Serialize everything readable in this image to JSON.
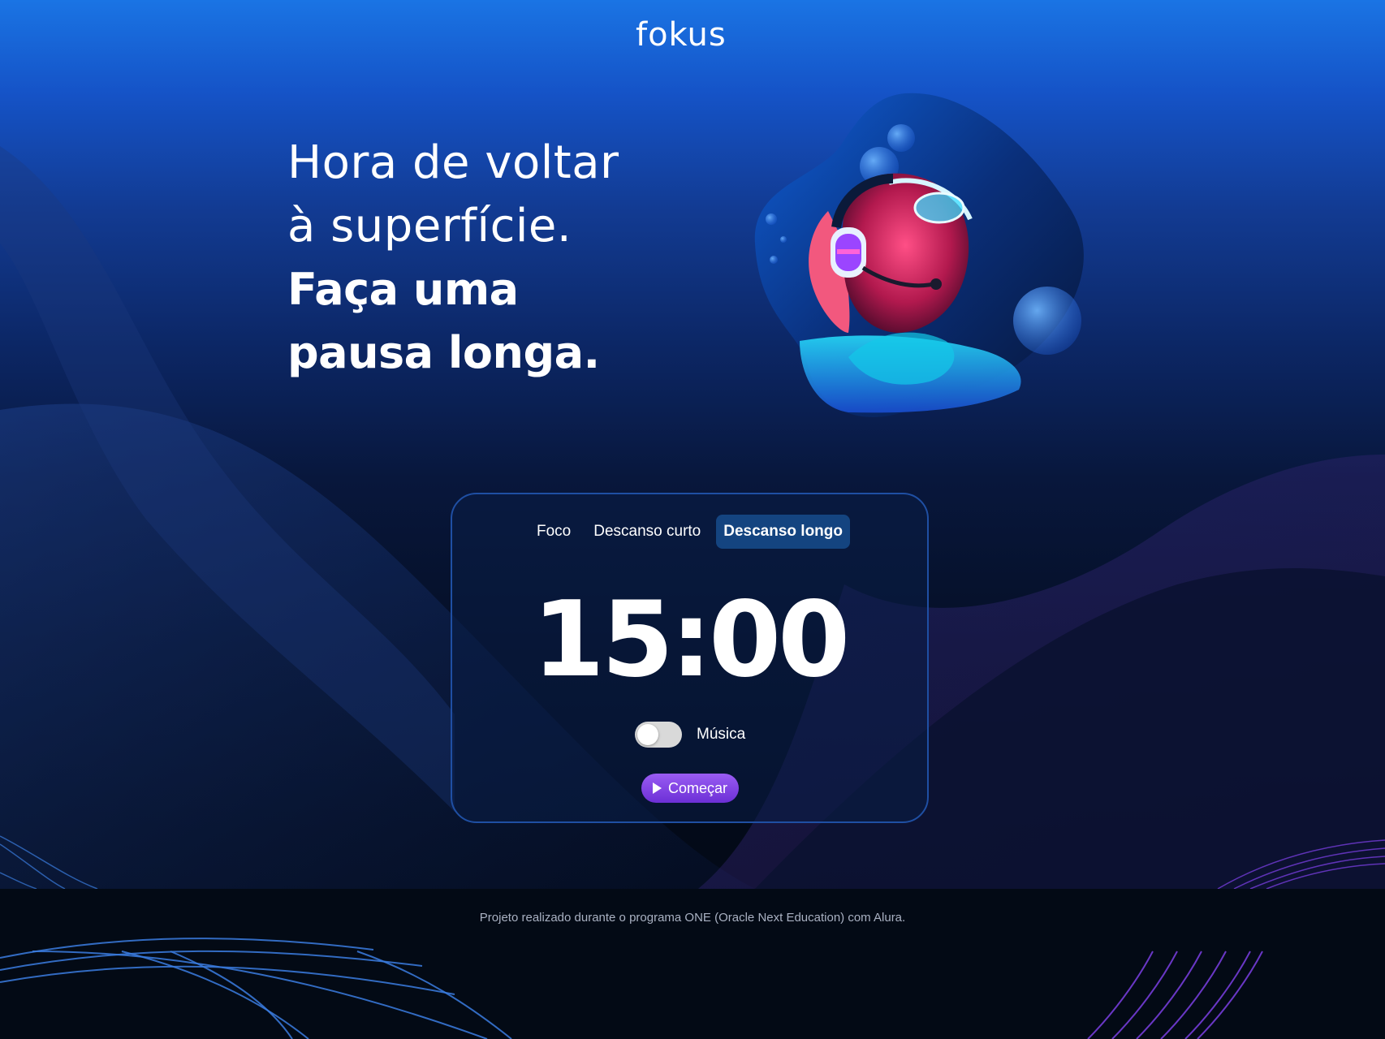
{
  "header": {
    "logo_text": "fokus"
  },
  "hero": {
    "line1": "Hora de voltar",
    "line2": "à superfície.",
    "line3": "Faça uma",
    "line4": "pausa longa."
  },
  "timer_card": {
    "tabs": [
      {
        "label": "Foco",
        "active": false
      },
      {
        "label": "Descanso curto",
        "active": false
      },
      {
        "label": "Descanso longo",
        "active": true
      }
    ],
    "time": "15:00",
    "music_label": "Música",
    "music_on": false,
    "start_label": "Começar"
  },
  "footer": {
    "text": "Projeto realizado durante o programa ONE (Oracle Next Education) com Alura."
  },
  "colors": {
    "active_tab_bg": "#144480",
    "start_button": "#7b3fe4",
    "card_border": "#1f4fa3"
  }
}
